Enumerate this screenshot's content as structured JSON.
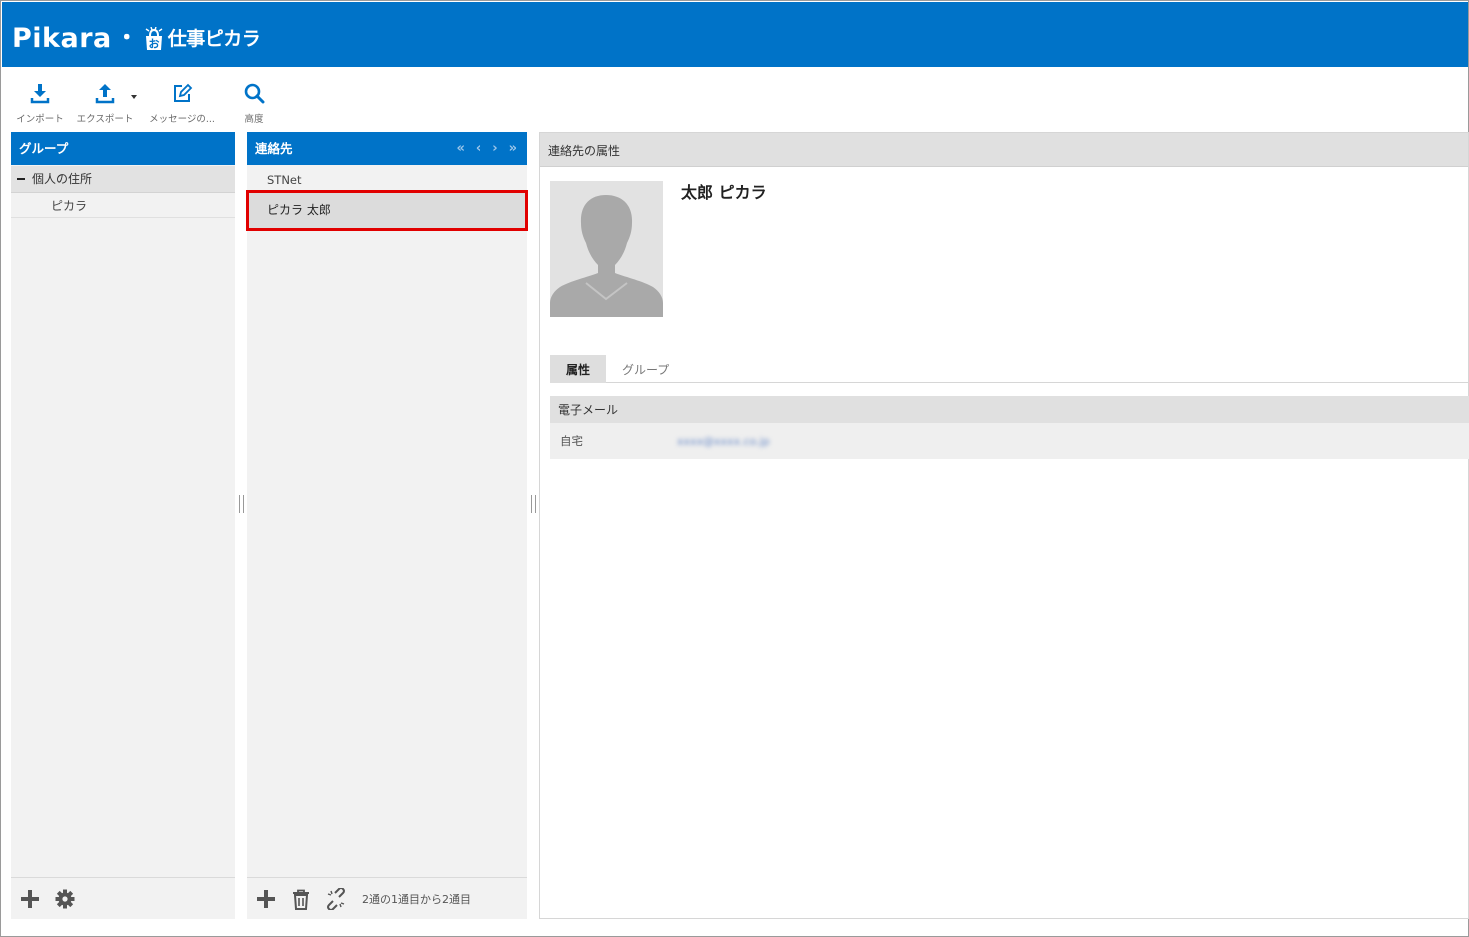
{
  "header": {
    "brand": "Pikara",
    "separator": "・",
    "service": "仕事ピカラ",
    "colors": {
      "primary": "#0073c8",
      "selection_outline": "#e10000"
    }
  },
  "toolbar": {
    "import_label": "インポート",
    "export_label": "エクスポート",
    "compose_label": "メッセージの...",
    "search_label": "高度"
  },
  "groups": {
    "title": "グループ",
    "root_label": "個人の住所",
    "children": [
      "ピカラ"
    ]
  },
  "contacts": {
    "title": "連絡先",
    "pager": [
      "«",
      "‹",
      "›",
      "»"
    ],
    "items": [
      "STNet",
      "ピカラ 太郎"
    ],
    "count_text": "2通の1通目から2通目"
  },
  "detail": {
    "title": "連絡先の属性",
    "name": "太郎 ピカラ",
    "tabs": [
      "属性",
      "グループ"
    ],
    "section_title": "電子メール",
    "email_label": "自宅",
    "email_value": "xxxx@xxxx.co.jp"
  }
}
